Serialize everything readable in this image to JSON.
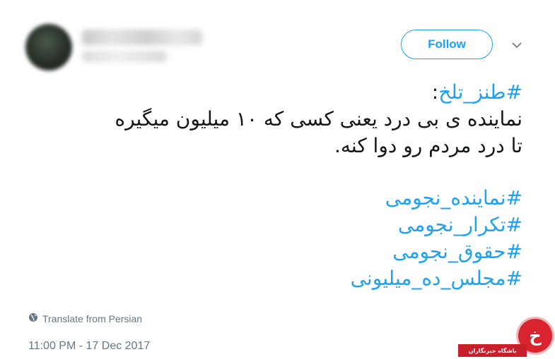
{
  "header": {
    "follow_label": "Follow"
  },
  "tweet": {
    "line1_hashtag": "#طنز_تلخ",
    "line1_colon": ":",
    "line2": "نماینده ی بی درد یعنی کسی که ۱۰ میلیون میگیره",
    "line3": "تا درد مردم رو دوا کنه.",
    "hashtags": [
      "#نماینده_نجومی",
      "#تکرار_نجومی",
      "#حقوق_نجومی",
      "#مجلس_ده_میلیونی"
    ]
  },
  "footer": {
    "translate_label": "Translate from Persian",
    "timestamp": "11:00 PM - 17 Dec 2017"
  },
  "watermark": {
    "symbol": "خ",
    "text": "باشگاه خبرنگاران"
  },
  "colors": {
    "accent": "#1da1f2",
    "text": "#14171a",
    "muted": "#657786",
    "watermark": "#d9232e"
  },
  "icons": {
    "caret": "chevron-down-icon",
    "translate": "globe-icon"
  }
}
